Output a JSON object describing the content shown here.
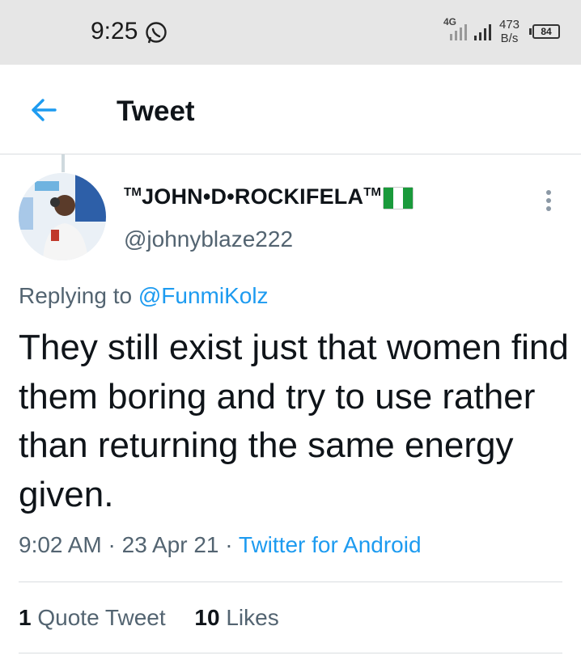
{
  "status_bar": {
    "time": "9:25",
    "network_type": "4G",
    "net_speed_value": "473",
    "net_speed_unit": "B/s",
    "battery": "84"
  },
  "header": {
    "title": "Tweet"
  },
  "tweet": {
    "author": {
      "display_name": "JOHN•D•ROCKIFELA",
      "tm_mark": "TM",
      "handle": "@johnyblaze222"
    },
    "reply_prefix": "Replying to",
    "reply_to": "@FunmiKolz",
    "text": "They still exist just that women find them boring and try to use rather than returning the same energy given.",
    "time": "9:02 AM",
    "separator": "·",
    "date": "23 Apr 21",
    "source": "Twitter for Android",
    "stats": {
      "quote_count": "1",
      "quote_label": "Quote Tweet",
      "like_count": "10",
      "like_label": "Likes"
    }
  },
  "colors": {
    "accent": "#1d9bf0",
    "secondary_text": "#536471",
    "primary_text": "#0f1419",
    "status_bar_bg": "#e6e6e6"
  },
  "icons": {
    "status": "whatsapp-icon",
    "back": "arrow-left-icon",
    "more": "more-vertical-icon",
    "flag": "nigeria-flag-icon"
  }
}
